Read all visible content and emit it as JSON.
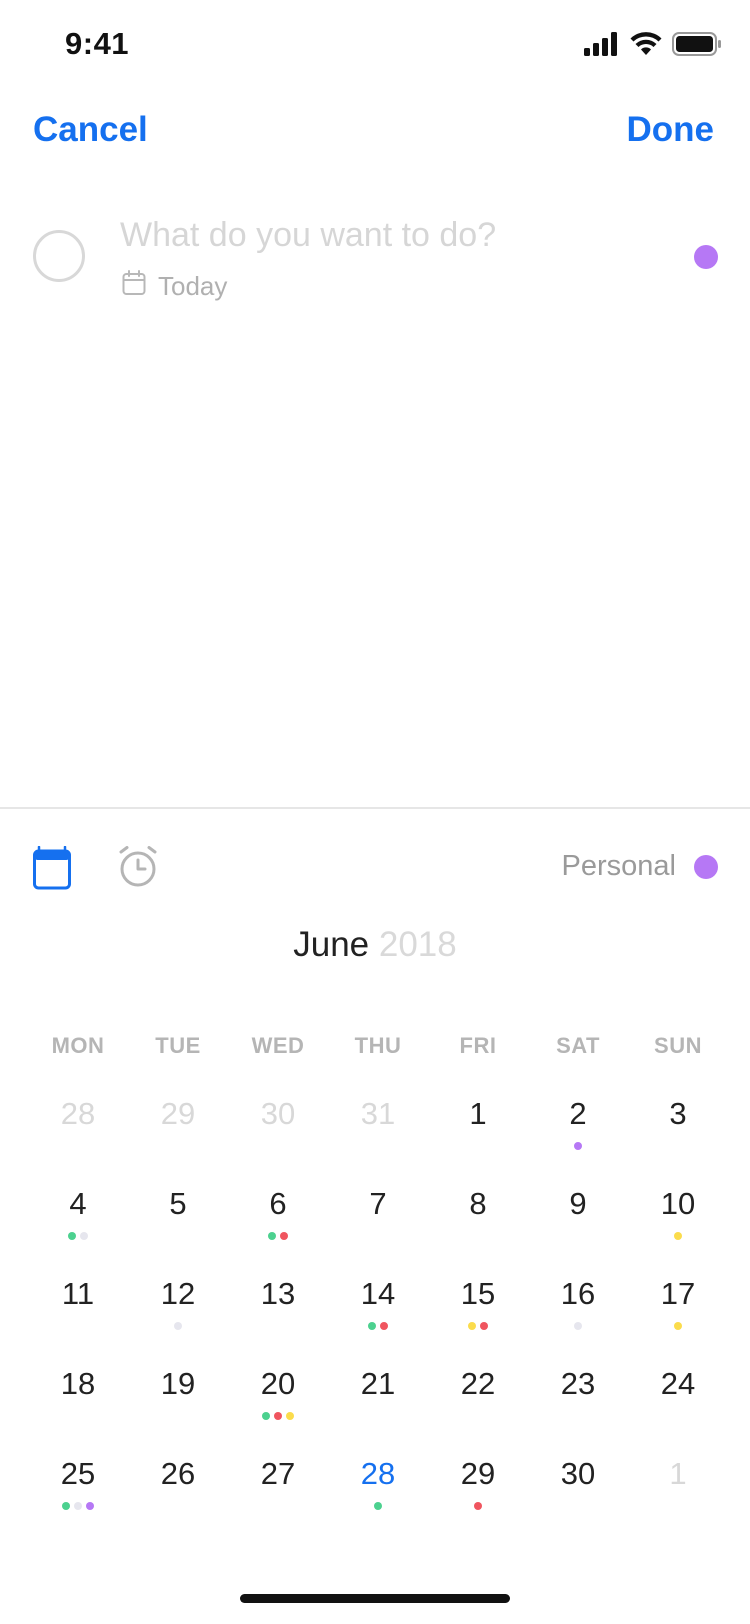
{
  "status_bar": {
    "time": "9:41"
  },
  "nav": {
    "cancel_label": "Cancel",
    "done_label": "Done"
  },
  "task": {
    "placeholder": "What do you want to do?",
    "date_label": "Today",
    "list_color": "#B678F5"
  },
  "toolbar": {
    "calendar_icon": "calendar-icon",
    "alarm_icon": "alarm-icon",
    "list_label": "Personal",
    "list_color": "#B678F5"
  },
  "colors": {
    "accent": "#1570EF",
    "green": "#4CD18F",
    "red": "#F0555F",
    "yellow": "#FBDC4C",
    "purple": "#B678F5",
    "gray": "#E6E6EE"
  },
  "calendar": {
    "month": "June",
    "year": "2018",
    "weekdays": [
      "MON",
      "TUE",
      "WED",
      "THU",
      "FRI",
      "SAT",
      "SUN"
    ],
    "days": [
      {
        "n": "28",
        "muted": true,
        "dots": []
      },
      {
        "n": "29",
        "muted": true,
        "dots": []
      },
      {
        "n": "30",
        "muted": true,
        "dots": []
      },
      {
        "n": "31",
        "muted": true,
        "dots": []
      },
      {
        "n": "1",
        "dots": []
      },
      {
        "n": "2",
        "dots": [
          "purple"
        ]
      },
      {
        "n": "3",
        "dots": []
      },
      {
        "n": "4",
        "dots": [
          "green",
          "gray"
        ]
      },
      {
        "n": "5",
        "dots": []
      },
      {
        "n": "6",
        "dots": [
          "green",
          "red"
        ]
      },
      {
        "n": "7",
        "dots": []
      },
      {
        "n": "8",
        "dots": []
      },
      {
        "n": "9",
        "dots": []
      },
      {
        "n": "10",
        "dots": [
          "yellow"
        ]
      },
      {
        "n": "11",
        "dots": []
      },
      {
        "n": "12",
        "dots": [
          "gray"
        ]
      },
      {
        "n": "13",
        "dots": []
      },
      {
        "n": "14",
        "dots": [
          "green",
          "red"
        ]
      },
      {
        "n": "15",
        "dots": [
          "yellow",
          "red"
        ]
      },
      {
        "n": "16",
        "dots": [
          "gray"
        ]
      },
      {
        "n": "17",
        "dots": [
          "yellow"
        ]
      },
      {
        "n": "18",
        "dots": []
      },
      {
        "n": "19",
        "dots": []
      },
      {
        "n": "20",
        "dots": [
          "green",
          "red",
          "yellow"
        ]
      },
      {
        "n": "21",
        "dots": []
      },
      {
        "n": "22",
        "dots": []
      },
      {
        "n": "23",
        "dots": []
      },
      {
        "n": "24",
        "dots": []
      },
      {
        "n": "25",
        "dots": [
          "green",
          "gray",
          "purple"
        ]
      },
      {
        "n": "26",
        "dots": []
      },
      {
        "n": "27",
        "dots": []
      },
      {
        "n": "28",
        "today": true,
        "dots": [
          "green"
        ]
      },
      {
        "n": "29",
        "dots": [
          "red"
        ]
      },
      {
        "n": "30",
        "dots": []
      },
      {
        "n": "1",
        "muted": true,
        "dots": []
      }
    ]
  }
}
